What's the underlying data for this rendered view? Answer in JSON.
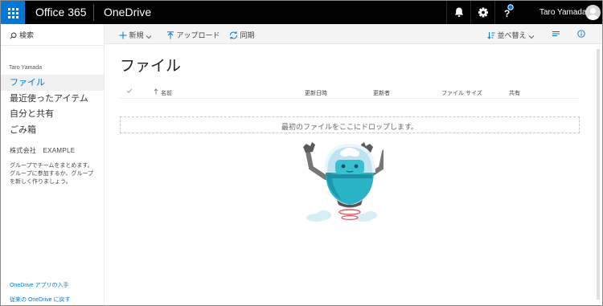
{
  "suite_bar": {
    "brand": "Office 365",
    "app_name": "OneDrive",
    "user_name": "Taro Yamada",
    "colors": {
      "waffle": "#0078d7",
      "bar": "#000000"
    }
  },
  "left_nav": {
    "search_label": "検索",
    "user_heading": "Taro Yamada",
    "items": [
      {
        "label": "ファイル",
        "active": true
      },
      {
        "label": "最近使ったアイテム",
        "active": false
      },
      {
        "label": "自分と共有",
        "active": false
      },
      {
        "label": "ごみ箱",
        "active": false
      }
    ],
    "group_heading": "株式会社　EXAMPLE",
    "group_description": "グループでチームをまとめます。グループに参加するか、グループを新しく作りましょう。",
    "footer_links": [
      "OneDrive アプリの入手",
      "従来の OneDrive に戻す"
    ]
  },
  "command_bar": {
    "new_label": "新規",
    "upload_label": "アップロード",
    "sync_label": "同期",
    "sort_label": "並べ替え"
  },
  "main": {
    "title": "ファイル",
    "columns": [
      "名前",
      "更新日時",
      "更新者",
      "ファイル サイズ",
      "共有"
    ],
    "drop_zone_text": "最初のファイルをここにドロップします。"
  }
}
